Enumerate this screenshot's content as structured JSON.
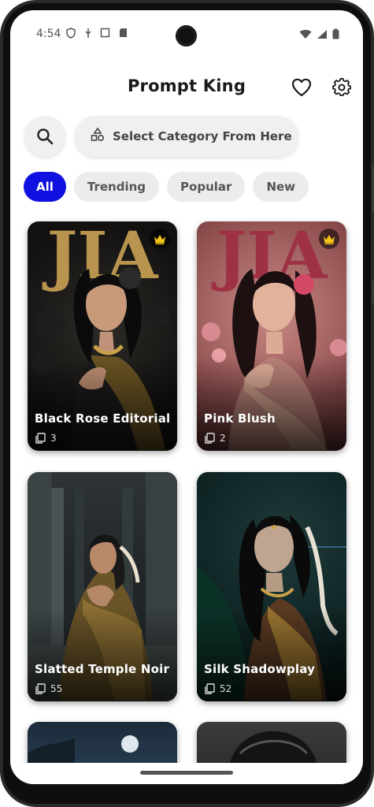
{
  "status_bar": {
    "time": "4:54"
  },
  "header": {
    "title": "Prompt King"
  },
  "category_select": {
    "label": "Select Category From Here"
  },
  "filters": [
    {
      "label": "All",
      "active": true
    },
    {
      "label": "Trending",
      "active": false
    },
    {
      "label": "Popular",
      "active": false
    },
    {
      "label": "New",
      "active": false
    }
  ],
  "cards": [
    {
      "title": "Black Rose Editorial",
      "count": "3",
      "premium": true,
      "logo_text": "JIA"
    },
    {
      "title": "Pink Blush",
      "count": "2",
      "premium": true,
      "logo_text": "JIA"
    },
    {
      "title": "Slatted Temple Noir",
      "count": "55",
      "premium": false
    },
    {
      "title": "Silk Shadowplay",
      "count": "52",
      "premium": false
    }
  ],
  "colors": {
    "accent": "#1010e0",
    "chip_bg": "#ececec",
    "crown": "#f5c518"
  }
}
